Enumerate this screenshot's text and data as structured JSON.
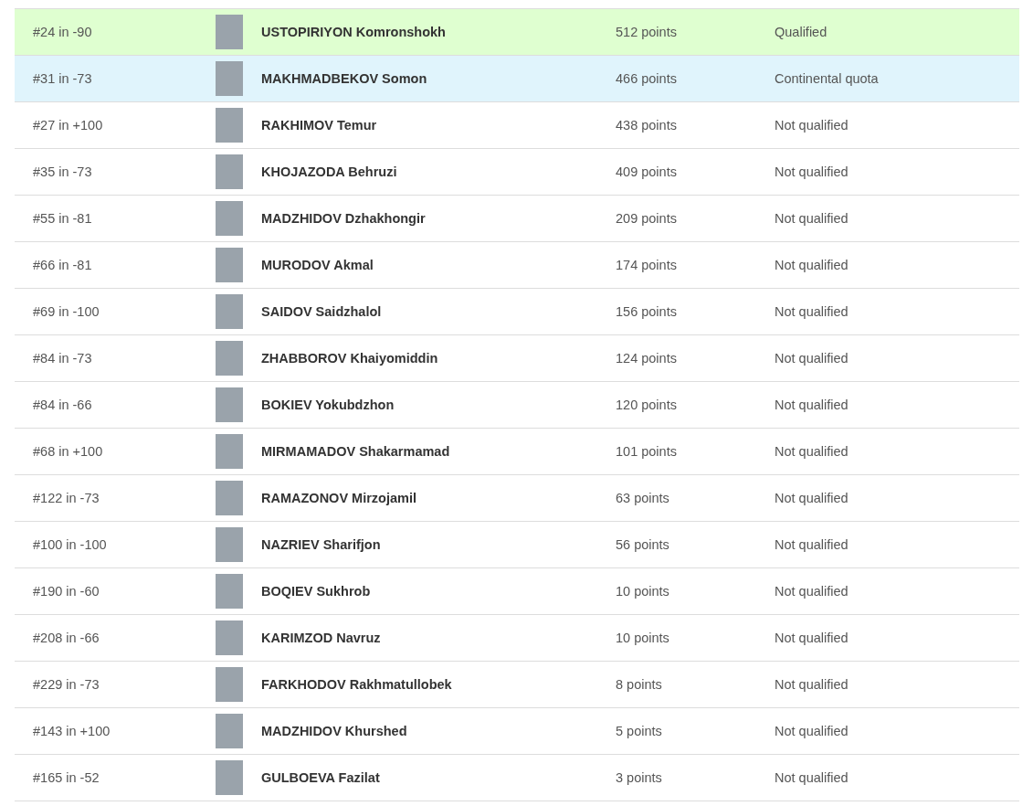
{
  "rows": [
    {
      "rank": "#24 in -90",
      "name": "USTOPIRIYON Komronshokh",
      "points": "512 points",
      "status": "Qualified",
      "kind": "qualified"
    },
    {
      "rank": "#31 in -73",
      "name": "MAKHMADBEKOV Somon",
      "points": "466 points",
      "status": "Continental quota",
      "kind": "quota"
    },
    {
      "rank": "#27 in +100",
      "name": "RAKHIMOV Temur",
      "points": "438 points",
      "status": "Not qualified",
      "kind": "none"
    },
    {
      "rank": "#35 in -73",
      "name": "KHOJAZODA Behruzi",
      "points": "409 points",
      "status": "Not qualified",
      "kind": "none"
    },
    {
      "rank": "#55 in -81",
      "name": "MADZHIDOV Dzhakhongir",
      "points": "209 points",
      "status": "Not qualified",
      "kind": "none"
    },
    {
      "rank": "#66 in -81",
      "name": "MURODOV Akmal",
      "points": "174 points",
      "status": "Not qualified",
      "kind": "none"
    },
    {
      "rank": "#69 in -100",
      "name": "SAIDOV Saidzhalol",
      "points": "156 points",
      "status": "Not qualified",
      "kind": "none"
    },
    {
      "rank": "#84 in -73",
      "name": "ZHABBOROV Khaiyomiddin",
      "points": "124 points",
      "status": "Not qualified",
      "kind": "none"
    },
    {
      "rank": "#84 in -66",
      "name": "BOKIEV Yokubdzhon",
      "points": "120 points",
      "status": "Not qualified",
      "kind": "none"
    },
    {
      "rank": "#68 in +100",
      "name": "MIRMAMADOV Shakarmamad",
      "points": "101 points",
      "status": "Not qualified",
      "kind": "none"
    },
    {
      "rank": "#122 in -73",
      "name": "RAMAZONOV Mirzojamil",
      "points": "63 points",
      "status": "Not qualified",
      "kind": "none"
    },
    {
      "rank": "#100 in -100",
      "name": "NAZRIEV Sharifjon",
      "points": "56 points",
      "status": "Not qualified",
      "kind": "none"
    },
    {
      "rank": "#190 in -60",
      "name": "BOQIEV Sukhrob",
      "points": "10 points",
      "status": "Not qualified",
      "kind": "none"
    },
    {
      "rank": "#208 in -66",
      "name": "KARIMZOD Navruz",
      "points": "10 points",
      "status": "Not qualified",
      "kind": "none"
    },
    {
      "rank": "#229 in -73",
      "name": "FARKHODOV Rakhmatullobek",
      "points": "8 points",
      "status": "Not qualified",
      "kind": "none"
    },
    {
      "rank": "#143 in +100",
      "name": "MADZHIDOV Khurshed",
      "points": "5 points",
      "status": "Not qualified",
      "kind": "none"
    },
    {
      "rank": "#165 in -52",
      "name": "GULBOEVA Fazilat",
      "points": "3 points",
      "status": "Not qualified",
      "kind": "none"
    }
  ]
}
